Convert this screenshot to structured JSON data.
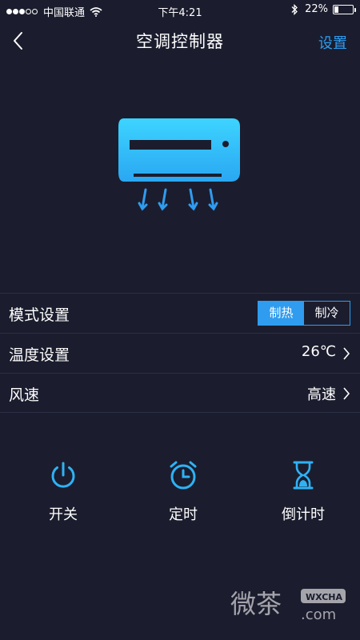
{
  "status_bar": {
    "carrier": "中国联通",
    "time": "下午4:21",
    "battery": "22%",
    "battery_level": 0.22
  },
  "nav": {
    "title": "空调控制器",
    "settings_label": "设置"
  },
  "settings": {
    "mode": {
      "label": "模式设置",
      "options": [
        "制热",
        "制冷"
      ],
      "selected": "制热"
    },
    "temperature": {
      "label": "温度设置",
      "value": "26℃"
    },
    "fan_speed": {
      "label": "风速",
      "value": "高速"
    }
  },
  "actions": [
    {
      "label": "开关",
      "icon": "power-icon"
    },
    {
      "label": "定时",
      "icon": "alarm-clock-icon"
    },
    {
      "label": "倒计时",
      "icon": "hourglass-icon"
    }
  ],
  "watermark": {
    "brand": "微茶",
    "badge": "WXCHA",
    "domain": ".com"
  },
  "colors": {
    "background": "#1b1d2e",
    "accent": "#2f9cf0",
    "illustration": "#33c8ff"
  }
}
